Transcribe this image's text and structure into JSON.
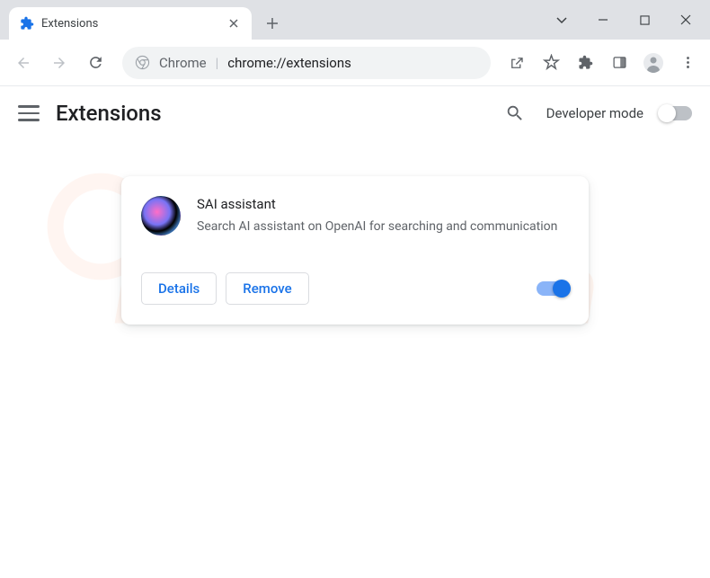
{
  "tab": {
    "title": "Extensions"
  },
  "omnibox": {
    "label": "Chrome",
    "url": "chrome://extensions"
  },
  "page": {
    "title": "Extensions",
    "developer_mode_label": "Developer mode"
  },
  "extension": {
    "name": "SAI assistant",
    "description": "Search AI assistant on OpenAI for searching and communication",
    "details_label": "Details",
    "remove_label": "Remove",
    "enabled": true
  }
}
